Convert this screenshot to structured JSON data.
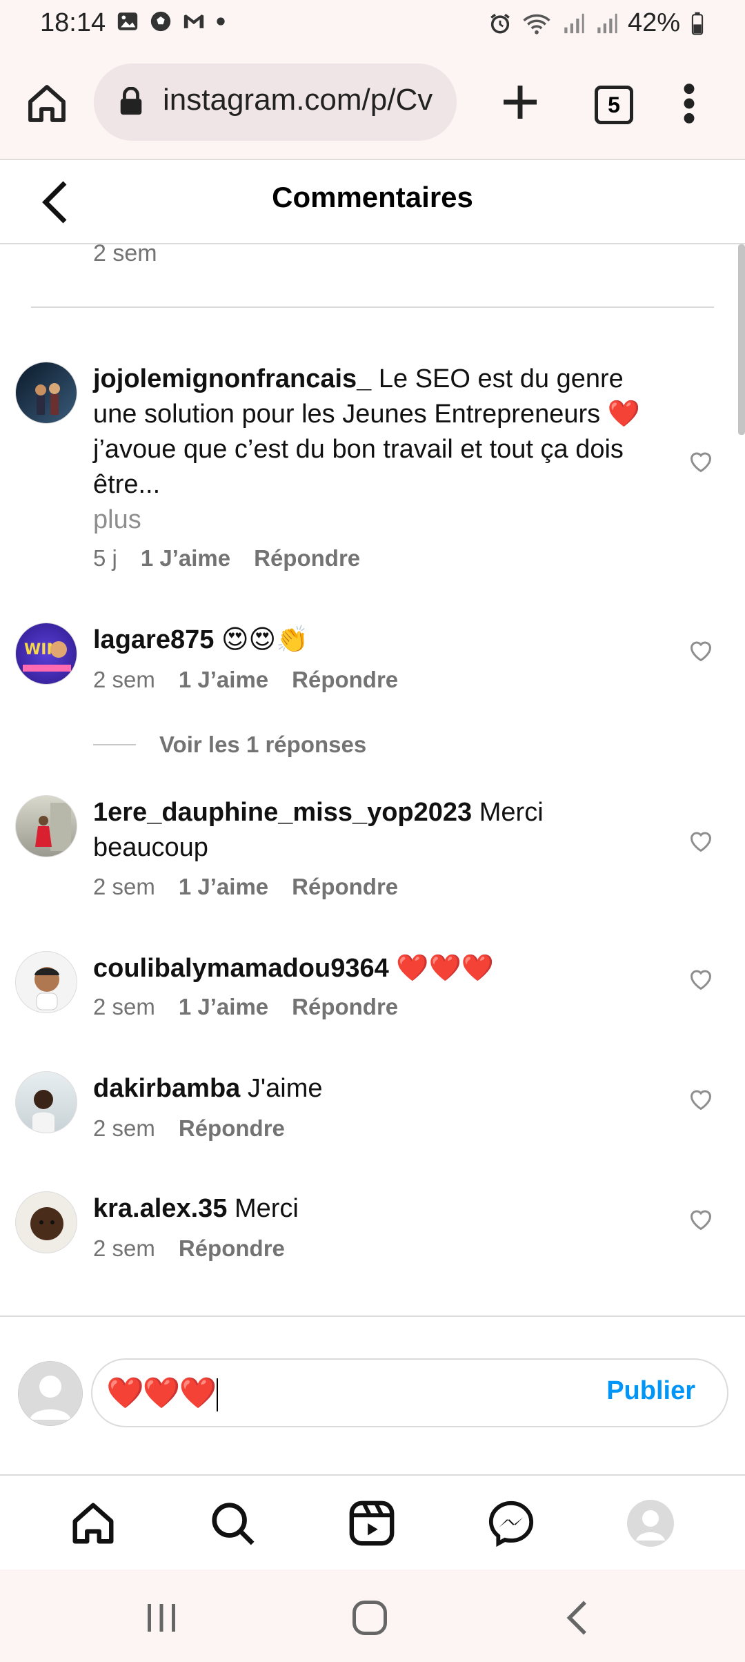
{
  "status_bar": {
    "time": "18:14",
    "battery": "42%",
    "left_icons": [
      "image-icon",
      "soccer-icon",
      "gmail-icon",
      "dot-icon"
    ],
    "right_icons": [
      "alarm-icon",
      "wifi-icon",
      "signal-icon",
      "signal-icon",
      "battery-icon"
    ]
  },
  "browser": {
    "url": "instagram.com/p/Cv",
    "tab_count": "5"
  },
  "header": {
    "title": "Commentaires"
  },
  "previous_comment_meta": "2 sem",
  "comments": [
    {
      "username": "jojolemignonfrancais_",
      "text": "Le SEO est du genre une solution pour les Jeunes Entrepreneurs ❤️ j’avoue que c’est du bon travail et tout ça dois être...",
      "more": "plus",
      "time": "5 j",
      "likes": "1 J’aime",
      "reply": "Répondre"
    },
    {
      "username": "lagare875",
      "text": "😍😍👏",
      "time": "2 sem",
      "likes": "1 J’aime",
      "reply": "Répondre",
      "view_replies": "Voir les 1 réponses"
    },
    {
      "username": "1ere_dauphine_miss_yop2023",
      "text": "Merci beaucoup",
      "time": "2 sem",
      "likes": "1 J’aime",
      "reply": "Répondre"
    },
    {
      "username": "coulibalymamadou9364",
      "text": "❤️❤️❤️",
      "time": "2 sem",
      "likes": "1 J’aime",
      "reply": "Répondre"
    },
    {
      "username": "dakirbamba",
      "text": "J'aime",
      "time": "2 sem",
      "reply": "Répondre"
    },
    {
      "username": "kra.alex.35",
      "text": "Merci",
      "time": "2 sem",
      "reply": "Répondre"
    }
  ],
  "composer": {
    "value": "❤️❤️❤️",
    "publish_label": "Publier"
  },
  "tab_bar": [
    "home-icon",
    "search-icon",
    "reels-icon",
    "messenger-icon",
    "profile-avatar"
  ],
  "colors": {
    "accent": "#0095f6",
    "heart_red": "#e0102b",
    "muted": "#737373"
  }
}
